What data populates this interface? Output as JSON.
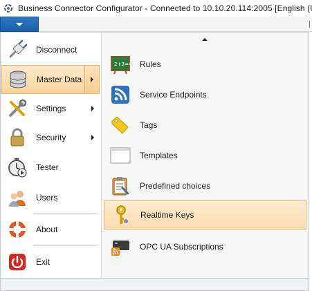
{
  "window": {
    "title": "Business Connector Configurator - Connected to 10.10.20.114:2005 [English (Unite",
    "app_icon": "connector-icon"
  },
  "app_menu_button": {
    "icon": "dropdown-triangle-icon"
  },
  "left_menu": {
    "items": [
      {
        "label": "Disconnect",
        "icon": "plug-icon",
        "has_submenu": false
      },
      {
        "label": "Master Data",
        "icon": "database-icon",
        "has_submenu": true,
        "active": true
      },
      {
        "label": "Settings",
        "icon": "tools-icon",
        "has_submenu": true
      },
      {
        "label": "Security",
        "icon": "lock-icon",
        "has_submenu": true
      },
      {
        "label": "Tester",
        "icon": "stopwatch-icon",
        "has_submenu": false
      },
      {
        "label": "Users",
        "icon": "users-icon",
        "has_submenu": false
      },
      {
        "label": "About",
        "icon": "lifebuoy-icon",
        "has_submenu": false
      },
      {
        "label": "Exit",
        "icon": "power-icon",
        "has_submenu": false
      }
    ]
  },
  "submenu": {
    "scroll_up_icon": "scroll-up-arrow-icon",
    "items": [
      {
        "label": "Rules",
        "icon": "chalkboard-icon"
      },
      {
        "label": "Service Endpoints",
        "icon": "rss-icon"
      },
      {
        "label": "Tags",
        "icon": "tag-icon"
      },
      {
        "label": "Templates",
        "icon": "template-window-icon"
      },
      {
        "label": "Predefined choices",
        "icon": "clipboard-choice-icon"
      },
      {
        "label": "Realtime Keys",
        "icon": "key-icon",
        "highlighted": true
      },
      {
        "label": "OPC UA Subscriptions",
        "icon": "opc-feed-icon"
      }
    ]
  },
  "colors": {
    "highlight_background": "#fbdcae",
    "highlight_border": "#e9b56e",
    "app_button_blue": "#1a5fa8"
  }
}
